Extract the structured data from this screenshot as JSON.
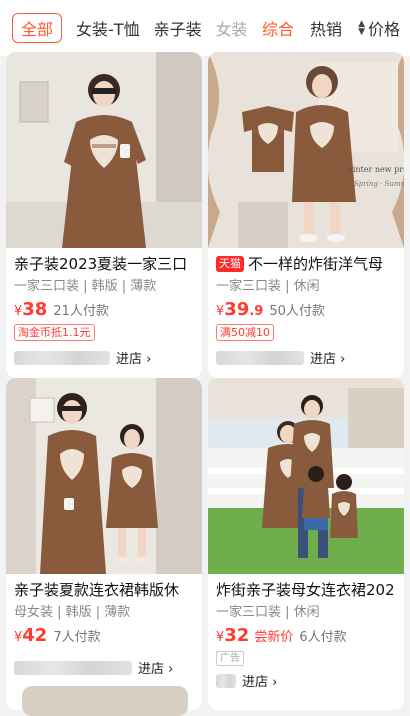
{
  "category_tabs": [
    {
      "label": "全部",
      "active": true
    },
    {
      "label": "女装-T恤",
      "active": false
    },
    {
      "label": "亲子装",
      "active": false
    },
    {
      "label": "女装",
      "active": false
    }
  ],
  "sort_tabs": [
    {
      "label": "综合",
      "active": true
    },
    {
      "label": "热销",
      "active": false
    },
    {
      "label": "价格",
      "active": false
    }
  ],
  "products": [
    {
      "title": "亲子装2023夏装一家三口",
      "badge": "",
      "attrs": "一家三口装 | 韩版 | 薄款",
      "currency": "¥",
      "price_int": "38",
      "price_dec": "",
      "try_new": "",
      "sold": "21人付款",
      "promo": "淘金币抵1.1元",
      "ad": "",
      "shop_action": "进店 ›"
    },
    {
      "title": "不一样的炸街洋气母",
      "badge": "天猫",
      "attrs": "一家三口装 | 休闲",
      "currency": "¥",
      "price_int": "39",
      "price_dec": ".9",
      "try_new": "",
      "sold": "50人付款",
      "promo": "满50减10",
      "ad": "",
      "shop_action": "进店 ›"
    },
    {
      "title": "亲子装夏款连衣裙韩版休",
      "badge": "",
      "attrs": "母女装 | 韩版 | 薄款",
      "currency": "¥",
      "price_int": "42",
      "price_dec": "",
      "try_new": "",
      "sold": "7人付款",
      "promo": "",
      "ad": "",
      "shop_action": "进店 ›"
    },
    {
      "title": "炸街亲子装母女连衣裙202",
      "badge": "",
      "attrs": "一家三口装 | 休闲",
      "currency": "¥",
      "price_int": "32",
      "price_dec": "",
      "try_new": "尝新价",
      "sold": "6人付款",
      "promo": "",
      "ad": "广告",
      "shop_action": "进店 ›"
    }
  ],
  "photo_texts": {
    "p2_caption_1": "winter new products",
    "p2_caption_2": "Spring · Summer"
  },
  "colors": {
    "accent": "#ff5a2b",
    "price": "#ff3b2f",
    "tmall": "#ff2a2a",
    "dress_brown": "#8a5a3c"
  }
}
